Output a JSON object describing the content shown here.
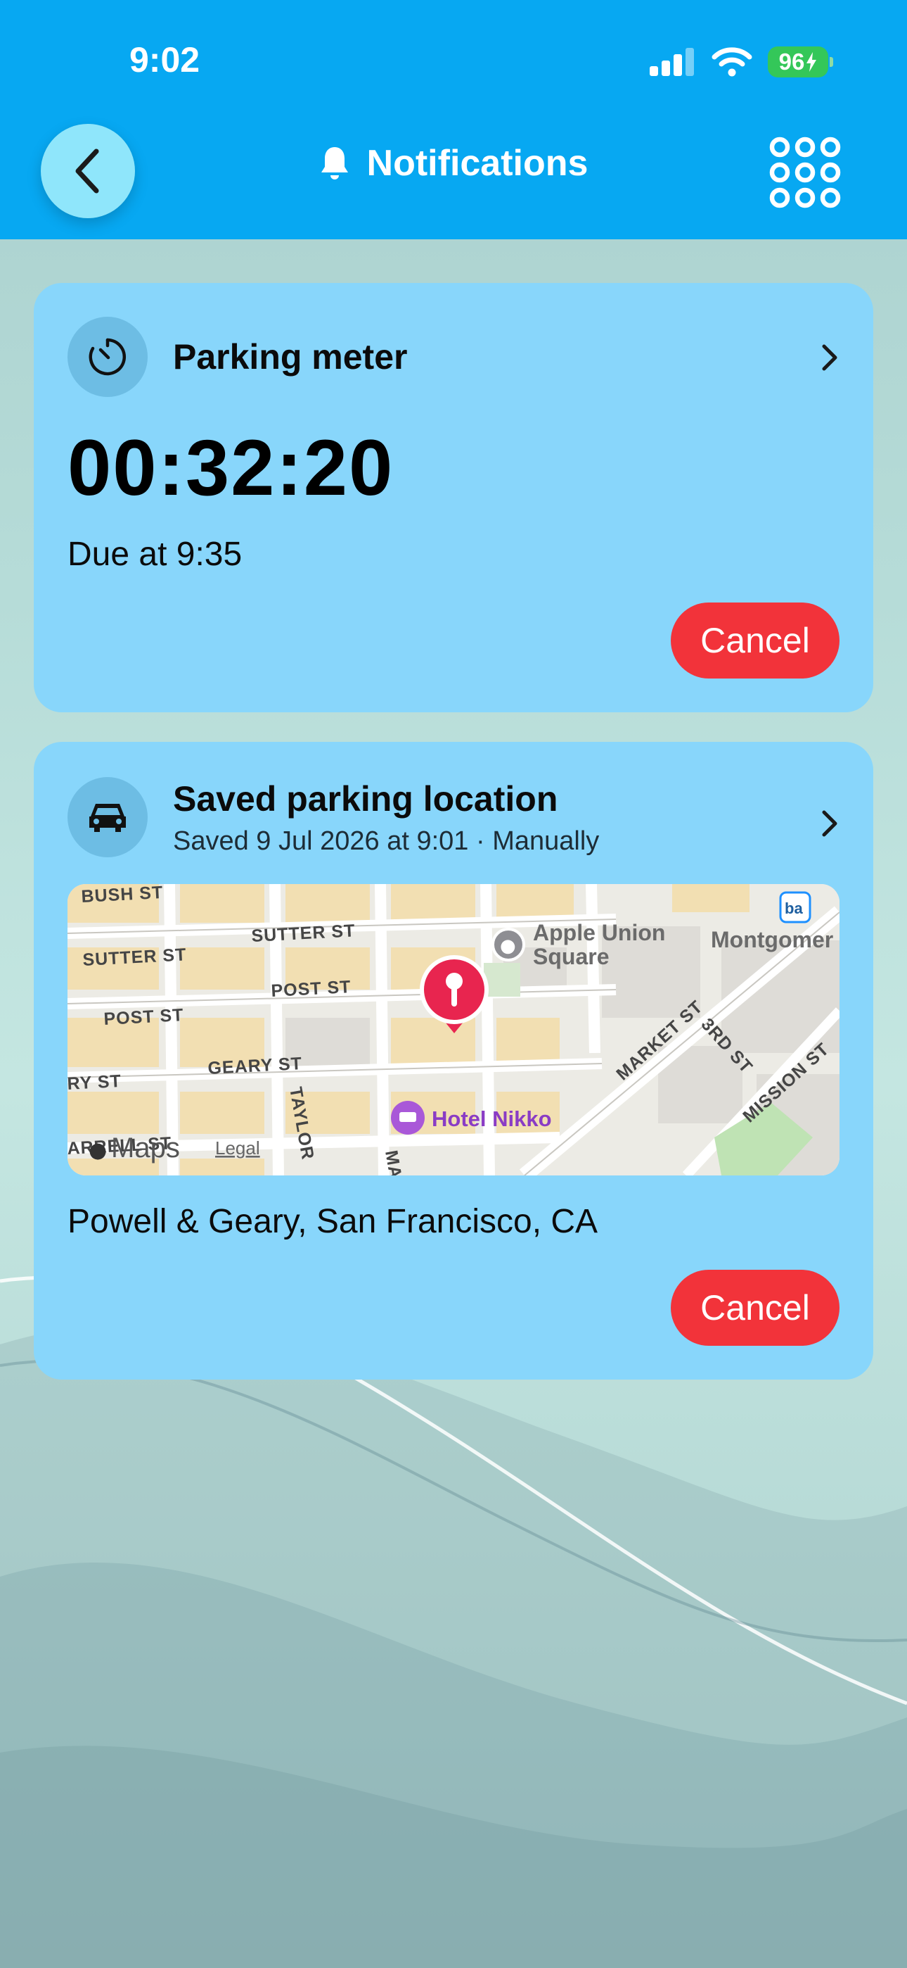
{
  "status_bar": {
    "time": "9:02",
    "battery": "96"
  },
  "header": {
    "title": "Notifications"
  },
  "parking_meter": {
    "title": "Parking meter",
    "timer": "00:32:20",
    "due": "Due at 9:35",
    "cancel_label": "Cancel"
  },
  "saved_location": {
    "title": "Saved parking location",
    "subtitle": "Saved 9 Jul 2026 at 9:01 · Manually",
    "address": "Powell & Geary, San Francisco, CA",
    "cancel_label": "Cancel",
    "map": {
      "streets": {
        "bush": "BUSH ST",
        "sutter_left": "SUTTER ST",
        "sutter_mid": "SUTTER ST",
        "post_left": "POST ST",
        "post_mid": "POST ST",
        "geary_left": "RY ST",
        "geary_mid": "GEARY ST",
        "farrell": "ARRELL ST",
        "taylor": "TAYLOR",
        "mason": "MAS",
        "market": "MARKET ST",
        "third": "3RD ST",
        "mission": "MISSION ST"
      },
      "pois": {
        "apple_line1": "Apple Union",
        "apple_line2": "Square",
        "montgomery": "Montgomer",
        "hotel": "Hotel Nikko"
      },
      "attribution": {
        "maps": "Maps",
        "legal": "Legal"
      }
    }
  },
  "colors": {
    "header": "#07a8f2",
    "card": "#88d6fb",
    "icon_circle": "#6dbde4",
    "cancel": "#f2333a",
    "pin": "#e8254f",
    "battery": "#34c759"
  }
}
